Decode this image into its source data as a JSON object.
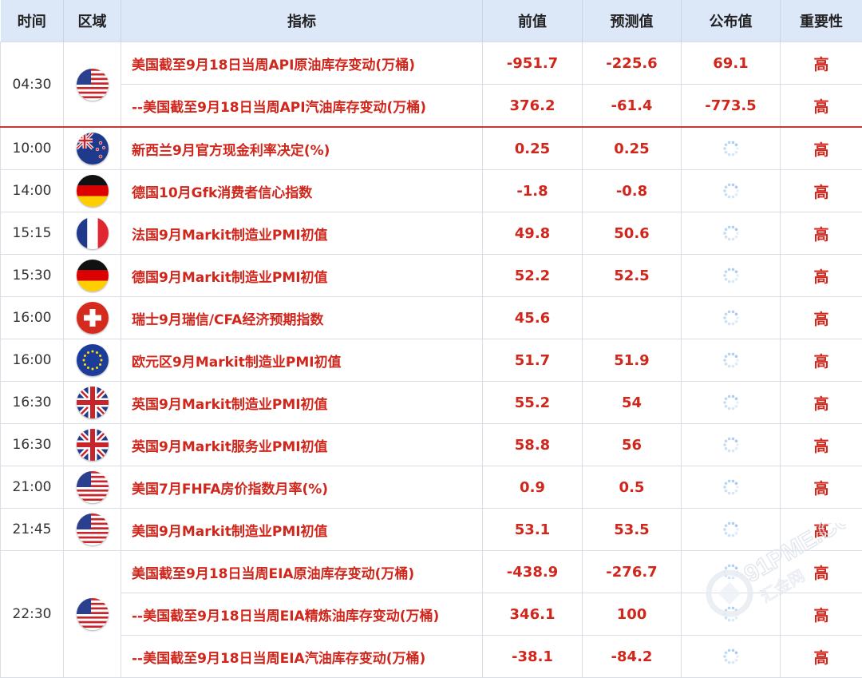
{
  "header": {
    "time": "时间",
    "region": "区域",
    "indicator": "指标",
    "previous": "前值",
    "forecast": "预测值",
    "actual": "公布值",
    "importance": "重要性"
  },
  "groups": [
    {
      "time": "04:30",
      "flag": "us-flag-icon",
      "rows": [
        {
          "name": "美国截至9月18日当周API原油库存变动(万桶)",
          "prev": "-951.7",
          "fcst": "-225.6",
          "actual": "69.1",
          "imp": "高"
        },
        {
          "name": "--美国截至9月18日当周API汽油库存变动(万桶)",
          "prev": "376.2",
          "fcst": "-61.4",
          "actual": "-773.5",
          "imp": "高"
        }
      ]
    },
    {
      "time": "10:00",
      "flag": "nz-flag-icon",
      "rows": [
        {
          "name": "新西兰9月官方现金利率决定(%)",
          "prev": "0.25",
          "fcst": "0.25",
          "actual": "",
          "imp": "高"
        }
      ]
    },
    {
      "time": "14:00",
      "flag": "de-flag-icon",
      "rows": [
        {
          "name": "德国10月Gfk消费者信心指数",
          "prev": "-1.8",
          "fcst": "-0.8",
          "actual": "",
          "imp": "高"
        }
      ]
    },
    {
      "time": "15:15",
      "flag": "fr-flag-icon",
      "rows": [
        {
          "name": "法国9月Markit制造业PMI初值",
          "prev": "49.8",
          "fcst": "50.6",
          "actual": "",
          "imp": "高"
        }
      ]
    },
    {
      "time": "15:30",
      "flag": "de-flag-icon",
      "rows": [
        {
          "name": "德国9月Markit制造业PMI初值",
          "prev": "52.2",
          "fcst": "52.5",
          "actual": "",
          "imp": "高"
        }
      ]
    },
    {
      "time": "16:00",
      "flag": "ch-flag-icon",
      "rows": [
        {
          "name": "瑞士9月瑞信/CFA经济预期指数",
          "prev": "45.6",
          "fcst": "",
          "actual": "",
          "imp": "高"
        }
      ]
    },
    {
      "time": "16:00",
      "flag": "eu-flag-icon",
      "rows": [
        {
          "name": "欧元区9月Markit制造业PMI初值",
          "prev": "51.7",
          "fcst": "51.9",
          "actual": "",
          "imp": "高"
        }
      ]
    },
    {
      "time": "16:30",
      "flag": "uk-flag-icon",
      "rows": [
        {
          "name": "英国9月Markit制造业PMI初值",
          "prev": "55.2",
          "fcst": "54",
          "actual": "",
          "imp": "高"
        }
      ]
    },
    {
      "time": "16:30",
      "flag": "uk-flag-icon",
      "rows": [
        {
          "name": "英国9月Markit服务业PMI初值",
          "prev": "58.8",
          "fcst": "56",
          "actual": "",
          "imp": "高"
        }
      ]
    },
    {
      "time": "21:00",
      "flag": "us-flag-icon",
      "rows": [
        {
          "name": "美国7月FHFA房价指数月率(%)",
          "prev": "0.9",
          "fcst": "0.5",
          "actual": "",
          "imp": "高"
        }
      ]
    },
    {
      "time": "21:45",
      "flag": "us-flag-icon",
      "rows": [
        {
          "name": "美国9月Markit制造业PMI初值",
          "prev": "53.1",
          "fcst": "53.5",
          "actual": "",
          "imp": "高"
        }
      ]
    },
    {
      "time": "22:30",
      "flag": "us-flag-icon",
      "rows": [
        {
          "name": "美国截至9月18日当周EIA原油库存变动(万桶)",
          "prev": "-438.9",
          "fcst": "-276.7",
          "actual": "",
          "imp": "高"
        },
        {
          "name": "--美国截至9月18日当周EIA精炼油库存变动(万桶)",
          "prev": "346.1",
          "fcst": "100",
          "actual": "",
          "imp": "高"
        },
        {
          "name": "--美国截至9月18日当周EIA汽油库存变动(万桶)",
          "prev": "-38.1",
          "fcst": "-84.2",
          "actual": "",
          "imp": "高"
        }
      ]
    }
  ],
  "watermark": {
    "text": "91PME.COM",
    "subtext": "汇金网",
    "icon": "watermark-logo-icon"
  },
  "colors": {
    "header_bg": "#dce7f8",
    "value_red": "#d0261b",
    "separator_red": "#c43a36"
  }
}
